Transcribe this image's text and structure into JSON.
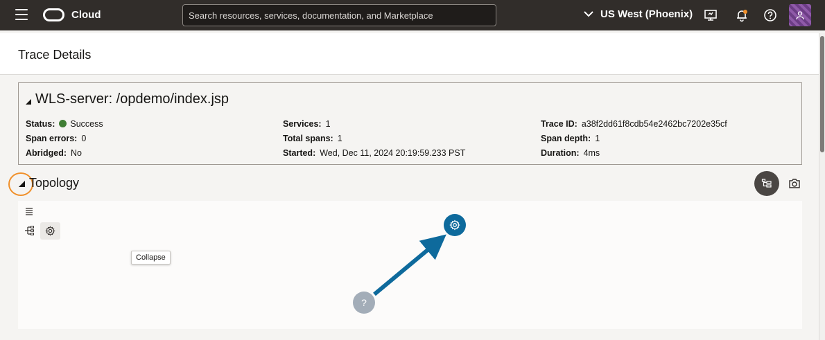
{
  "topbar": {
    "brand": "Cloud",
    "search_placeholder": "Search resources, services, documentation, and Marketplace",
    "region": "US West (Phoenix)"
  },
  "page": {
    "title": "Trace Details"
  },
  "summary": {
    "title": "WLS-server: /opdemo/index.jsp",
    "status_label": "Status:",
    "status_value": "Success",
    "span_errors_label": "Span errors:",
    "span_errors_value": "0",
    "abridged_label": "Abridged:",
    "abridged_value": "No",
    "services_label": "Services:",
    "services_value": "1",
    "total_spans_label": "Total spans:",
    "total_spans_value": "1",
    "started_label": "Started:",
    "started_value": "Wed, Dec 11, 2024 20:19:59.233 PST",
    "trace_id_label": "Trace ID:",
    "trace_id_value": "a38f2dd61f8cdb54e2462bc7202e35cf",
    "span_depth_label": "Span depth:",
    "span_depth_value": "1",
    "duration_label": "Duration:",
    "duration_value": "4ms"
  },
  "topology": {
    "title": "Topology",
    "tooltip": "Collapse",
    "unknown_node_glyph": "?"
  },
  "colors": {
    "topbar_bg": "#312d2a",
    "success": "#3f7e34",
    "node_service": "#0e6a9c",
    "node_unknown": "#a3adb8",
    "highlight": "#f0902a"
  },
  "icons": [
    "hamburger-icon",
    "oracle-logo-icon",
    "chevron-down-icon",
    "monitor-icon",
    "bell-icon",
    "help-icon",
    "user-icon",
    "hierarchy-view-icon",
    "camera-icon",
    "menu-lines-icon",
    "layout-icon",
    "gear-icon"
  ]
}
